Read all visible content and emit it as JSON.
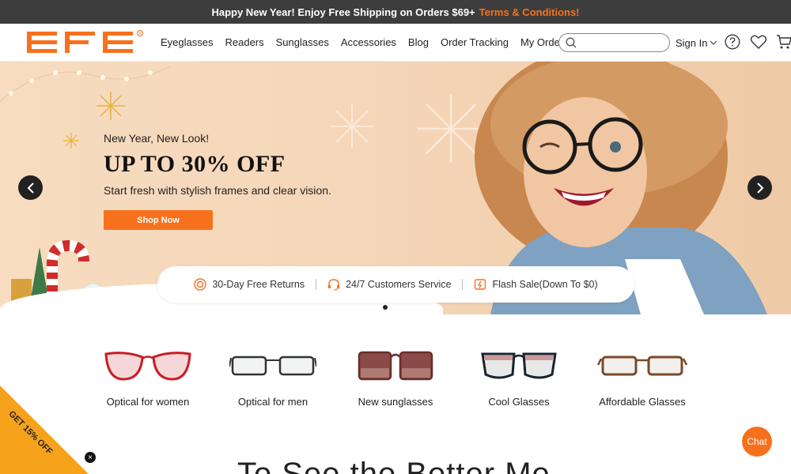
{
  "announcement": {
    "text": "Happy New Year! Enjoy Free Shipping on Orders $69+",
    "link": "Terms & Conditions!"
  },
  "header": {
    "logo_text": "EFE",
    "nav": [
      "Eyeglasses",
      "Readers",
      "Sunglasses",
      "Accessories",
      "Blog",
      "Order Tracking",
      "My Orders"
    ],
    "search_placeholder": "",
    "sign_in": "Sign In"
  },
  "hero": {
    "subtitle": "New Year, New Look!",
    "title": "UP TO 30% OFF",
    "description": "Start fresh with stylish frames and clear vision.",
    "cta": "Shop Now",
    "features": [
      "30-Day Free Returns",
      "24/7 Customers Service",
      "Flash Sale(Down To $0)"
    ],
    "slide_count": 1
  },
  "categories": [
    "Optical for women",
    "Optical for men",
    "New sunglasses",
    "Cool Glasses",
    "Affordable Glasses"
  ],
  "section_heading": "To See the Better Me",
  "ribbon": {
    "text": "GET 15% OFF",
    "close": "×"
  },
  "chat_label": "Chat",
  "colors": {
    "accent": "#f7711c",
    "topbar": "#3d3d3d",
    "ribbon": "#f7a21b"
  }
}
